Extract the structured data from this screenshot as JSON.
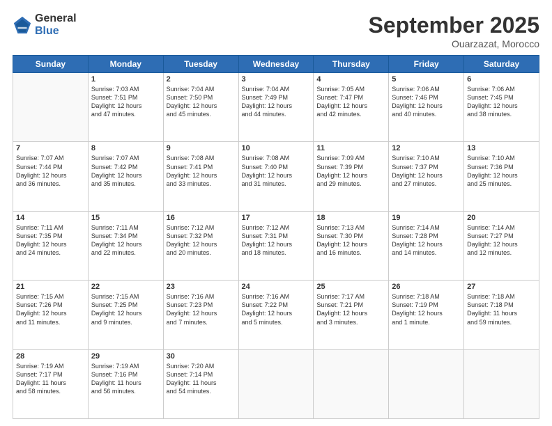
{
  "header": {
    "logo_line1": "General",
    "logo_line2": "Blue",
    "month_title": "September 2025",
    "subtitle": "Ouarzazat, Morocco"
  },
  "days_of_week": [
    "Sunday",
    "Monday",
    "Tuesday",
    "Wednesday",
    "Thursday",
    "Friday",
    "Saturday"
  ],
  "weeks": [
    [
      {
        "day": "",
        "info": ""
      },
      {
        "day": "1",
        "info": "Sunrise: 7:03 AM\nSunset: 7:51 PM\nDaylight: 12 hours\nand 47 minutes."
      },
      {
        "day": "2",
        "info": "Sunrise: 7:04 AM\nSunset: 7:50 PM\nDaylight: 12 hours\nand 45 minutes."
      },
      {
        "day": "3",
        "info": "Sunrise: 7:04 AM\nSunset: 7:49 PM\nDaylight: 12 hours\nand 44 minutes."
      },
      {
        "day": "4",
        "info": "Sunrise: 7:05 AM\nSunset: 7:47 PM\nDaylight: 12 hours\nand 42 minutes."
      },
      {
        "day": "5",
        "info": "Sunrise: 7:06 AM\nSunset: 7:46 PM\nDaylight: 12 hours\nand 40 minutes."
      },
      {
        "day": "6",
        "info": "Sunrise: 7:06 AM\nSunset: 7:45 PM\nDaylight: 12 hours\nand 38 minutes."
      }
    ],
    [
      {
        "day": "7",
        "info": "Sunrise: 7:07 AM\nSunset: 7:44 PM\nDaylight: 12 hours\nand 36 minutes."
      },
      {
        "day": "8",
        "info": "Sunrise: 7:07 AM\nSunset: 7:42 PM\nDaylight: 12 hours\nand 35 minutes."
      },
      {
        "day": "9",
        "info": "Sunrise: 7:08 AM\nSunset: 7:41 PM\nDaylight: 12 hours\nand 33 minutes."
      },
      {
        "day": "10",
        "info": "Sunrise: 7:08 AM\nSunset: 7:40 PM\nDaylight: 12 hours\nand 31 minutes."
      },
      {
        "day": "11",
        "info": "Sunrise: 7:09 AM\nSunset: 7:39 PM\nDaylight: 12 hours\nand 29 minutes."
      },
      {
        "day": "12",
        "info": "Sunrise: 7:10 AM\nSunset: 7:37 PM\nDaylight: 12 hours\nand 27 minutes."
      },
      {
        "day": "13",
        "info": "Sunrise: 7:10 AM\nSunset: 7:36 PM\nDaylight: 12 hours\nand 25 minutes."
      }
    ],
    [
      {
        "day": "14",
        "info": "Sunrise: 7:11 AM\nSunset: 7:35 PM\nDaylight: 12 hours\nand 24 minutes."
      },
      {
        "day": "15",
        "info": "Sunrise: 7:11 AM\nSunset: 7:34 PM\nDaylight: 12 hours\nand 22 minutes."
      },
      {
        "day": "16",
        "info": "Sunrise: 7:12 AM\nSunset: 7:32 PM\nDaylight: 12 hours\nand 20 minutes."
      },
      {
        "day": "17",
        "info": "Sunrise: 7:12 AM\nSunset: 7:31 PM\nDaylight: 12 hours\nand 18 minutes."
      },
      {
        "day": "18",
        "info": "Sunrise: 7:13 AM\nSunset: 7:30 PM\nDaylight: 12 hours\nand 16 minutes."
      },
      {
        "day": "19",
        "info": "Sunrise: 7:14 AM\nSunset: 7:28 PM\nDaylight: 12 hours\nand 14 minutes."
      },
      {
        "day": "20",
        "info": "Sunrise: 7:14 AM\nSunset: 7:27 PM\nDaylight: 12 hours\nand 12 minutes."
      }
    ],
    [
      {
        "day": "21",
        "info": "Sunrise: 7:15 AM\nSunset: 7:26 PM\nDaylight: 12 hours\nand 11 minutes."
      },
      {
        "day": "22",
        "info": "Sunrise: 7:15 AM\nSunset: 7:25 PM\nDaylight: 12 hours\nand 9 minutes."
      },
      {
        "day": "23",
        "info": "Sunrise: 7:16 AM\nSunset: 7:23 PM\nDaylight: 12 hours\nand 7 minutes."
      },
      {
        "day": "24",
        "info": "Sunrise: 7:16 AM\nSunset: 7:22 PM\nDaylight: 12 hours\nand 5 minutes."
      },
      {
        "day": "25",
        "info": "Sunrise: 7:17 AM\nSunset: 7:21 PM\nDaylight: 12 hours\nand 3 minutes."
      },
      {
        "day": "26",
        "info": "Sunrise: 7:18 AM\nSunset: 7:19 PM\nDaylight: 12 hours\nand 1 minute."
      },
      {
        "day": "27",
        "info": "Sunrise: 7:18 AM\nSunset: 7:18 PM\nDaylight: 11 hours\nand 59 minutes."
      }
    ],
    [
      {
        "day": "28",
        "info": "Sunrise: 7:19 AM\nSunset: 7:17 PM\nDaylight: 11 hours\nand 58 minutes."
      },
      {
        "day": "29",
        "info": "Sunrise: 7:19 AM\nSunset: 7:16 PM\nDaylight: 11 hours\nand 56 minutes."
      },
      {
        "day": "30",
        "info": "Sunrise: 7:20 AM\nSunset: 7:14 PM\nDaylight: 11 hours\nand 54 minutes."
      },
      {
        "day": "",
        "info": ""
      },
      {
        "day": "",
        "info": ""
      },
      {
        "day": "",
        "info": ""
      },
      {
        "day": "",
        "info": ""
      }
    ]
  ]
}
